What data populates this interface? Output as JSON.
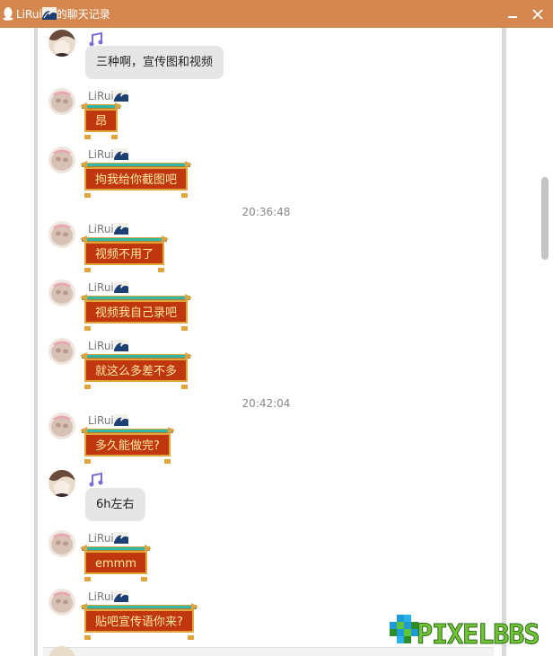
{
  "window": {
    "title_name": "LiRui",
    "title_suffix": "的聊天记录",
    "icons": [
      "qq-penguin-icon",
      "wave-emoji-icon",
      "minimize-icon",
      "close-icon"
    ]
  },
  "messages": [
    {
      "kind": "msg",
      "from": "self",
      "sender": "",
      "text": "三种啊，宣传图和视频"
    },
    {
      "kind": "msg",
      "from": "other",
      "sender": "LiRui",
      "text": "昂"
    },
    {
      "kind": "msg",
      "from": "other",
      "sender": "LiRui",
      "text": "拘我给你截图吧"
    },
    {
      "kind": "time",
      "text": "20:36:48"
    },
    {
      "kind": "msg",
      "from": "other",
      "sender": "LiRui",
      "text": "视频不用了"
    },
    {
      "kind": "msg",
      "from": "other",
      "sender": "LiRui",
      "text": "视频我自己录吧"
    },
    {
      "kind": "msg",
      "from": "other",
      "sender": "LiRui",
      "text": "就这么多差不多"
    },
    {
      "kind": "time",
      "text": "20:42:04"
    },
    {
      "kind": "msg",
      "from": "other",
      "sender": "LiRui",
      "text": "多久能做完?"
    },
    {
      "kind": "msg",
      "from": "self",
      "sender": "",
      "text": "6h左右"
    },
    {
      "kind": "msg",
      "from": "other",
      "sender": "LiRui",
      "text": "emmm"
    },
    {
      "kind": "msg",
      "from": "other",
      "sender": "LiRui",
      "text": "贴吧宣传语你来?"
    }
  ],
  "watermark": {
    "text": "PIXELBBS"
  },
  "colors": {
    "titlebar": "#d4874f",
    "bubble_self": "#e6e6e6",
    "bubble_other": "#c0360d",
    "bubble_other_text": "#ffe9a6",
    "bubble_trim_gold": "#e2a53c",
    "bubble_trim_teal": "#2fb8a8"
  }
}
